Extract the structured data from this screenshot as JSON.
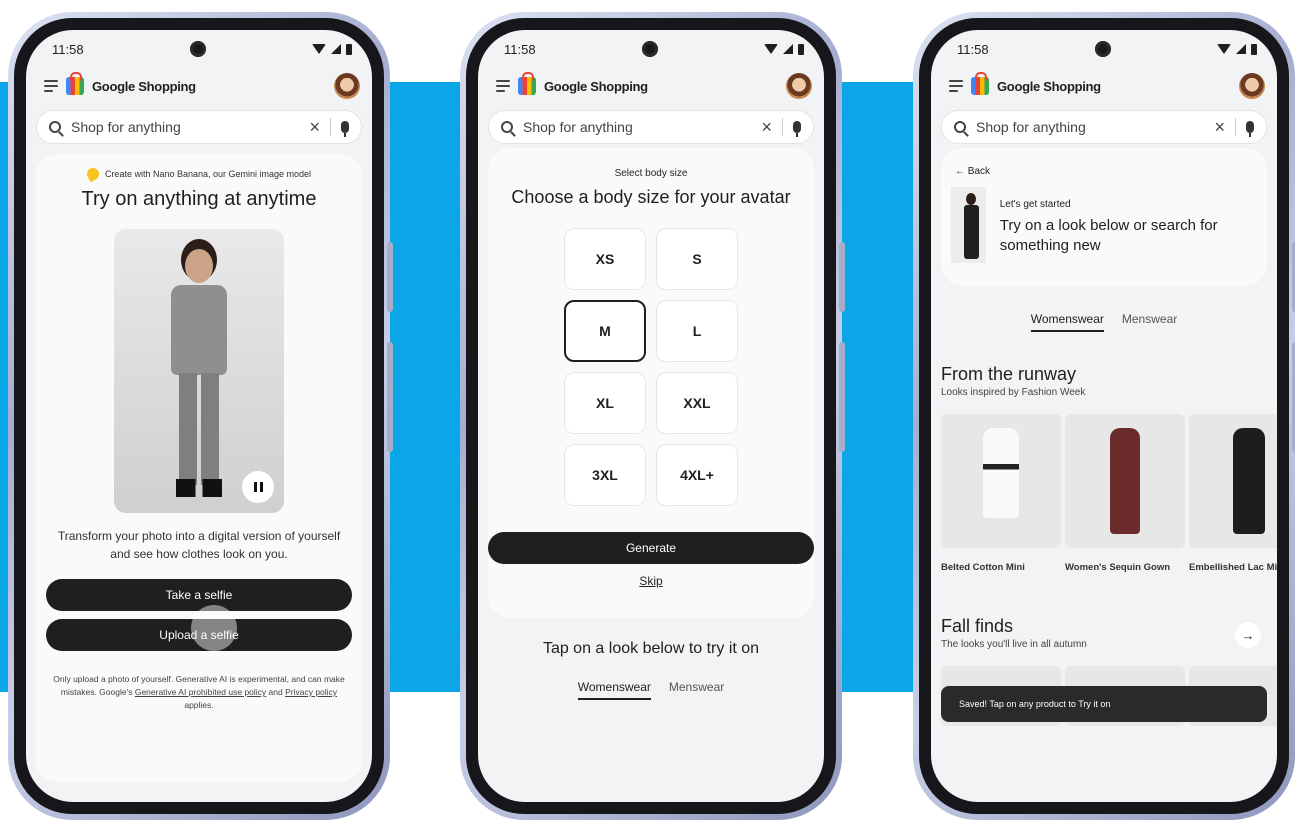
{
  "colors": {
    "accent_band": "#0aa6e8",
    "button_dark": "#1f1f1f"
  },
  "status": {
    "time": "11:58"
  },
  "brand": "Google Shopping",
  "search": {
    "placeholder": "Shop for anything"
  },
  "phone1": {
    "banner": "Create with Nano Banana, our Gemini image model",
    "title": "Try on anything at anytime",
    "description": "Transform your photo into a digital version of yourself and see how clothes look on you.",
    "take_selfie": "Take a selfie",
    "upload_selfie": "Upload a selfie",
    "legal_prefix": "Only upload a photo of yourself. Generative AI is experimental, and can make mistakes. Google's ",
    "legal_link1": "Generative AI prohibited use policy",
    "legal_and": " and ",
    "legal_link2": "Privacy policy",
    "legal_suffix": " applies."
  },
  "phone2": {
    "pre": "Select body size",
    "title": "Choose a body size for your avatar",
    "sizes": [
      "XS",
      "S",
      "M",
      "L",
      "XL",
      "XXL",
      "3XL",
      "4XL+"
    ],
    "selected": "M",
    "generate": "Generate",
    "skip": "Skip",
    "tapline": "Tap on a look below to try it on",
    "tabs": [
      "Womenswear",
      "Menswear"
    ]
  },
  "phone3": {
    "back": "Back",
    "start_pre": "Let's get started",
    "start_title": "Try on a look below or search for something new",
    "tabs": [
      "Womenswear",
      "Menswear"
    ],
    "runway_title": "From the runway",
    "runway_sub": "Looks inspired by Fashion Week",
    "products": [
      "Belted Cotton Mini",
      "Women's Sequin Gown",
      "Embellished Lac Midi"
    ],
    "fall_title": "Fall finds",
    "fall_sub": "The looks you'll live in all autumn",
    "toast": "Saved! Tap on any product to Try it on"
  }
}
